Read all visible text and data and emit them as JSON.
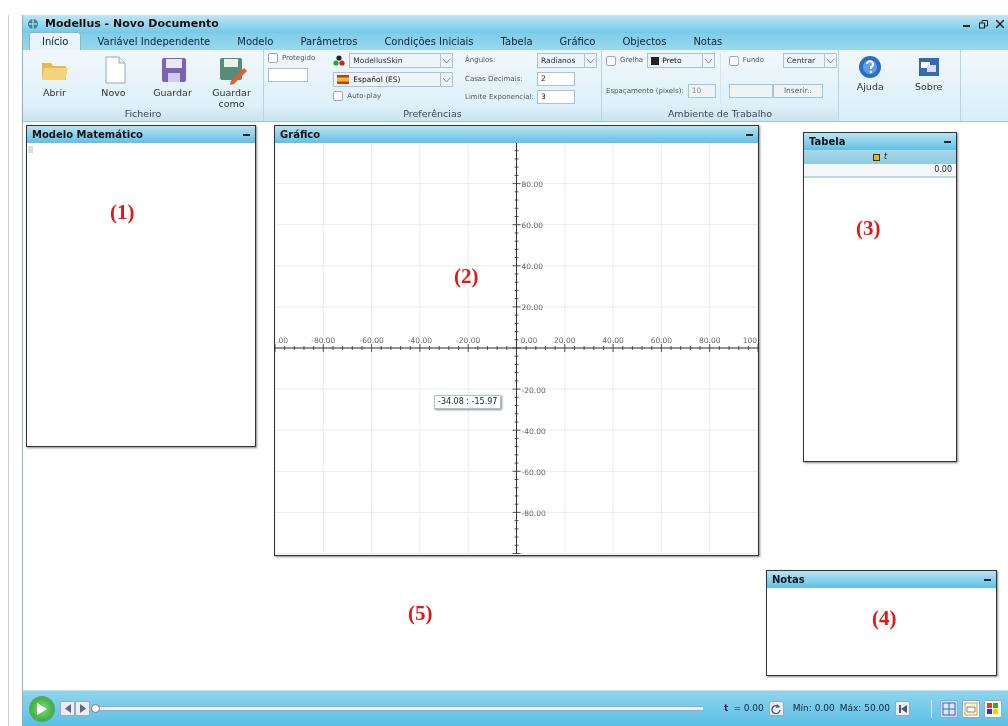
{
  "window": {
    "title": "Modellus - Novo Documento"
  },
  "tabs": [
    {
      "label": "Início",
      "selected": true
    },
    {
      "label": "Variável Independente",
      "selected": false
    },
    {
      "label": "Modelo",
      "selected": false
    },
    {
      "label": "Parâmetros",
      "selected": false
    },
    {
      "label": "Condições Iniciais",
      "selected": false
    },
    {
      "label": "Tabela",
      "selected": false
    },
    {
      "label": "Gráfico",
      "selected": false
    },
    {
      "label": "Objectos",
      "selected": false
    },
    {
      "label": "Notas",
      "selected": false
    }
  ],
  "ficheiro": {
    "title": "Ficheiro",
    "buttons": [
      "Abrir",
      "Novo",
      "Guardar",
      "Guardar como"
    ]
  },
  "preferencias": {
    "title": "Preferências",
    "protegido": {
      "label": "Protegido",
      "checked": false
    },
    "skin": "ModellusSkin",
    "language": "Español (ES)",
    "autoplay": {
      "label": "Auto-play",
      "checked": false
    },
    "fields": [
      {
        "label": "Ângulos:",
        "kind": "select",
        "value": "Radianos"
      },
      {
        "label": "Casas Decimais:",
        "kind": "input",
        "value": "2"
      },
      {
        "label": "Limite Exponencial:",
        "kind": "input",
        "value": "3"
      }
    ]
  },
  "ambiente": {
    "title": "Ambiente de Trabalho",
    "grelha": {
      "label": "Grelha",
      "checked": false
    },
    "grid_color": {
      "value": "Preto",
      "color": "#222222"
    },
    "fundo": {
      "label": "Fundo",
      "checked": false
    },
    "position": "Centrar",
    "spacing_label": "Espaçamento (pixels):",
    "spacing": "10",
    "insert_button": "Inserir.."
  },
  "help_buttons": [
    "Ajuda",
    "Sobre"
  ],
  "panels": {
    "modelo": {
      "title": "Modelo Matemático",
      "callout": "(1)"
    },
    "grafico": {
      "title": "Gráfico",
      "callout": "(2)",
      "x_tick_labels": [
        ".00",
        "-80.00",
        "-60.00",
        "-40.00",
        "-20.00",
        "0.00",
        "20.00",
        "40.00",
        "60.00",
        "80.00",
        "100"
      ],
      "y_tick_labels": [
        "80.00",
        "60.00",
        "40.00",
        "20.00",
        "-20.00",
        "-40.00",
        "-60.00",
        "-80.00"
      ],
      "cursor_readout": "-34.08 : -15.97"
    },
    "tabela": {
      "title": "Tabela",
      "callout": "(3)",
      "column": "t",
      "rows": [
        "0.00"
      ]
    },
    "notas": {
      "title": "Notas",
      "callout": "(4)"
    }
  },
  "workspace_callout": "(5)",
  "player": {
    "level": 0,
    "t_label": "t",
    "t_value": "= 0.00",
    "min": "Mín: 0.00",
    "max": "Máx: 50.00"
  }
}
